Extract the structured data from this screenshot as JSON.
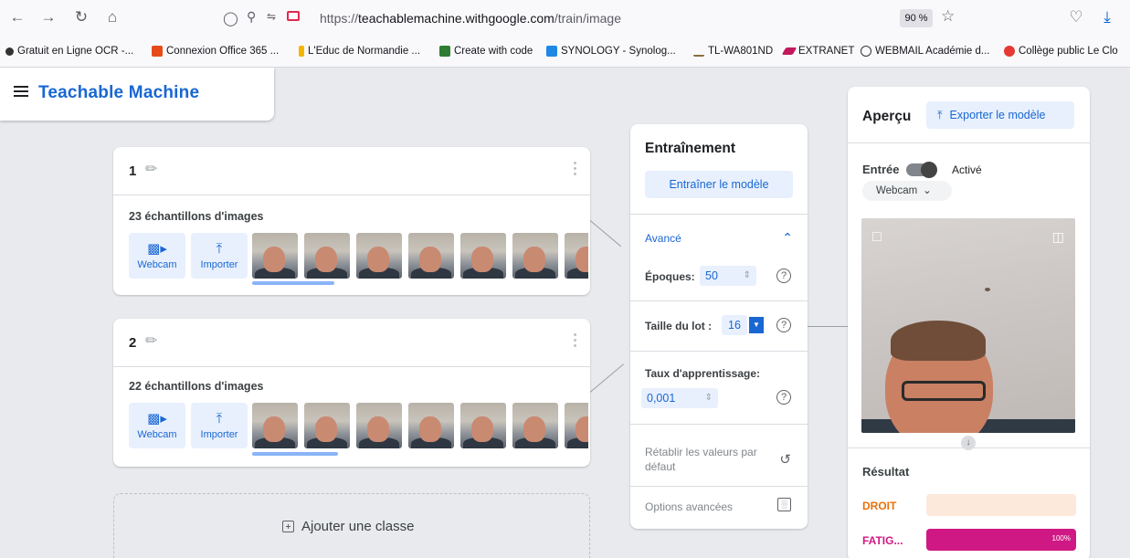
{
  "browser": {
    "url_prefix": "https://",
    "url_host": "teachablemachine.withgoogle.com",
    "url_path": "/train/image",
    "zoom": "90 %",
    "bookmarks": [
      "Gratuit en Ligne OCR -...",
      "Connexion Office 365 ...",
      "L'Educ de Normandie ...",
      "Create with code",
      "SYNOLOGY - Synolog...",
      "TL-WA801ND",
      "EXTRANET",
      "WEBMAIL Académie d...",
      "Collège public Le Clo"
    ]
  },
  "app": {
    "title": "Teachable Machine"
  },
  "classes": [
    {
      "name": "1",
      "samples": "23 échantillons d'images",
      "webcam": "Webcam",
      "import": "Importer"
    },
    {
      "name": "2",
      "samples": "22 échantillons d'images",
      "webcam": "Webcam",
      "import": "Importer"
    }
  ],
  "add_class": "Ajouter une classe",
  "training": {
    "title": "Entraînement",
    "train_button": "Entraîner le modèle",
    "advanced": "Avancé",
    "epochs_label": "Époques:",
    "epochs_value": "50",
    "batch_label": "Taille du lot :",
    "batch_value": "16",
    "lr_label": "Taux d'apprentissage:",
    "lr_value": "0,001",
    "reset_line1": "Rétablir les valeurs par",
    "reset_line2": "défaut",
    "advanced_options": "Options avancées"
  },
  "preview": {
    "title": "Aperçu",
    "export_button": "Exporter le modèle",
    "input_label": "Entrée",
    "active_label": "Activé",
    "source": "Webcam",
    "result_title": "Résultat",
    "results": [
      {
        "label": "DROIT",
        "value": 0,
        "color": "#e8710a",
        "bar_bg": "#fde8dc"
      },
      {
        "label": "FATIG...",
        "value": 100,
        "pct": "100%",
        "color": "#d01884",
        "bar_bg": "#f3c1d0"
      }
    ]
  }
}
